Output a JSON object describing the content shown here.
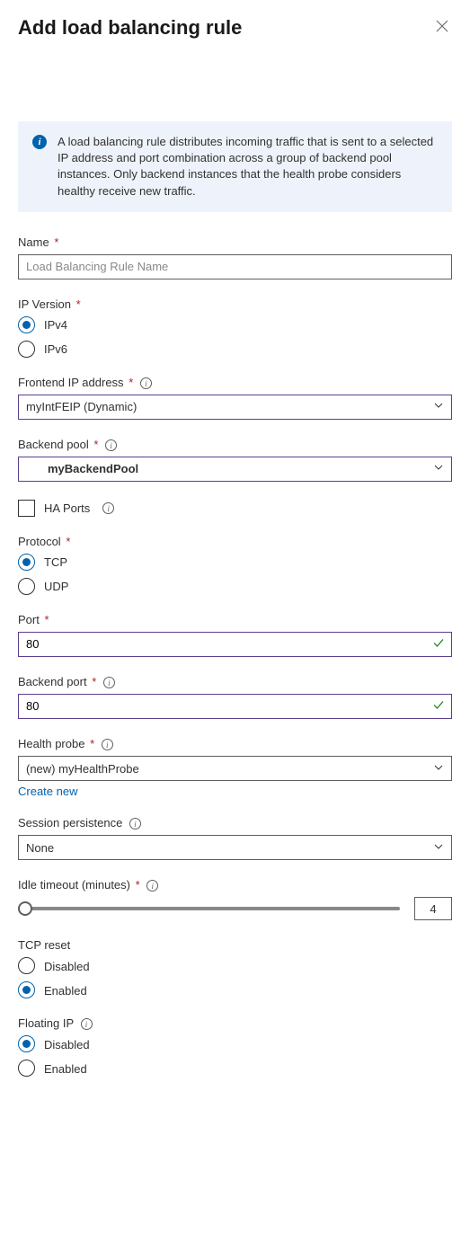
{
  "header": {
    "title": "Add load balancing rule"
  },
  "info": {
    "text": "A load balancing rule distributes incoming traffic that is sent to a selected IP address and port combination across a group of backend pool instances. Only backend instances that the health probe considers healthy receive new traffic."
  },
  "fields": {
    "name": {
      "label": "Name",
      "placeholder": "Load Balancing Rule Name",
      "value": ""
    },
    "ip_version": {
      "label": "IP Version",
      "options": [
        "IPv4",
        "IPv6"
      ],
      "selected": "IPv4"
    },
    "frontend_ip": {
      "label": "Frontend IP address",
      "value": "myIntFEIP (Dynamic)"
    },
    "backend_pool": {
      "label": "Backend pool",
      "value": "myBackendPool"
    },
    "ha_ports": {
      "label": "HA Ports",
      "checked": false
    },
    "protocol": {
      "label": "Protocol",
      "options": [
        "TCP",
        "UDP"
      ],
      "selected": "TCP"
    },
    "port": {
      "label": "Port",
      "value": "80"
    },
    "backend_port": {
      "label": "Backend port",
      "value": "80"
    },
    "health_probe": {
      "label": "Health probe",
      "value": "(new) myHealthProbe",
      "create_new": "Create new"
    },
    "session_persistence": {
      "label": "Session persistence",
      "value": "None"
    },
    "idle_timeout": {
      "label": "Idle timeout (minutes)",
      "value": "4"
    },
    "tcp_reset": {
      "label": "TCP reset",
      "options": [
        "Disabled",
        "Enabled"
      ],
      "selected": "Enabled"
    },
    "floating_ip": {
      "label": "Floating IP",
      "options": [
        "Disabled",
        "Enabled"
      ],
      "selected": "Disabled"
    }
  }
}
